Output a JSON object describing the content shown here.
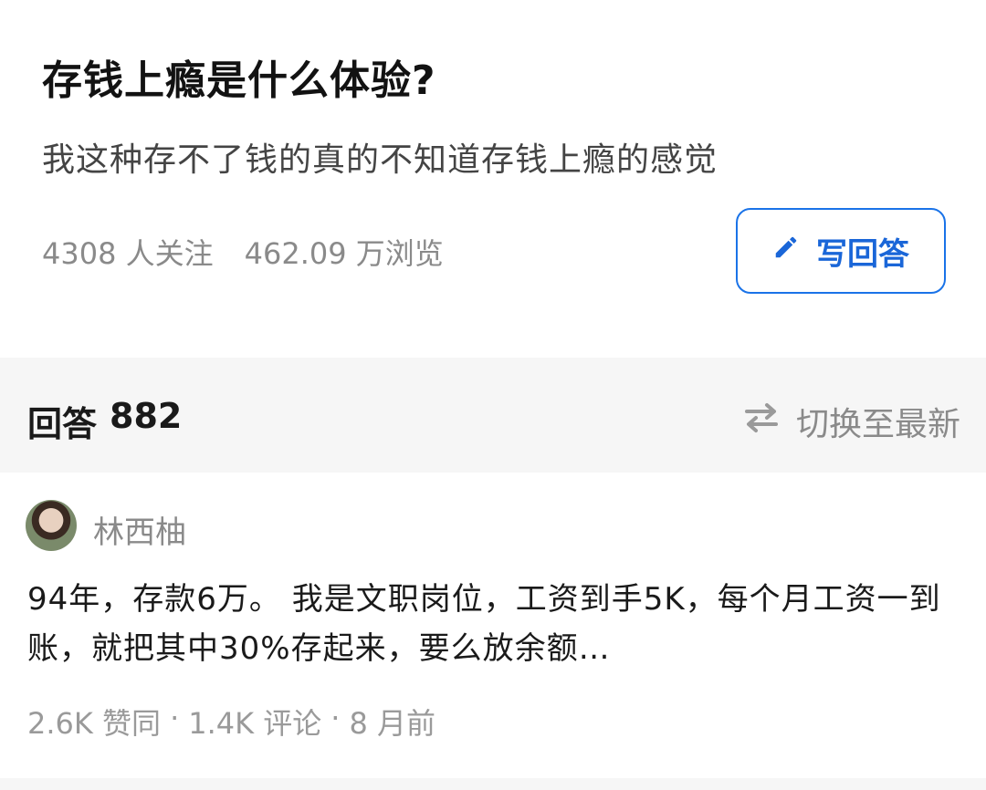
{
  "question": {
    "title": "存钱上瘾是什么体验?",
    "description": "我这种存不了钱的真的不知道存钱上瘾的感觉",
    "followers": "4308 人关注",
    "views": "462.09 万浏览",
    "write_answer_label": "写回答"
  },
  "answers_header": {
    "label": "回答",
    "count": "882",
    "sort_label": "切换至最新"
  },
  "answer": {
    "author": "林西柚",
    "excerpt": "94年，存款6万。 我是文职岗位，工资到手5K，每个月工资一到账，就把其中30%存起来，要么放余额…",
    "likes": "2.6K 赞同",
    "comments": "1.4K 评论",
    "time": "8 月前",
    "separator": "·"
  },
  "colors": {
    "accent": "#1a66d8",
    "muted": "#8a8a8a",
    "background": "#f6f6f6"
  },
  "icons": {
    "write": "pencil-icon",
    "sort": "swap-arrows-icon",
    "avatar": "user-avatar"
  }
}
